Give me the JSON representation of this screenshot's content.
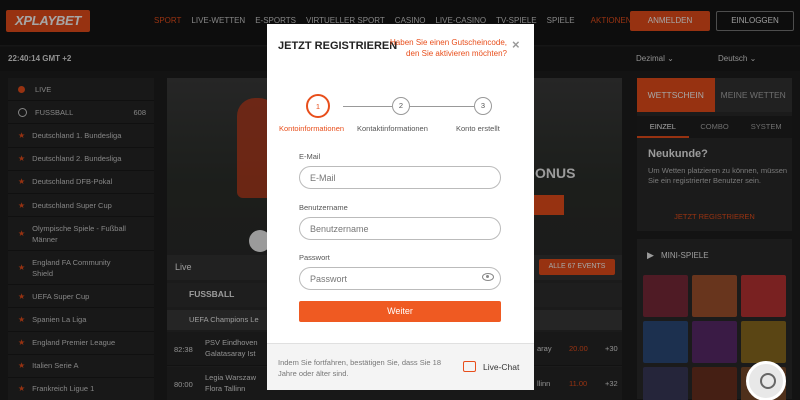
{
  "header": {
    "logo": "XPLAYBET",
    "nav": [
      "SPORT",
      "LIVE-WETTEN",
      "E-SPORTS",
      "VIRTUELLER SPORT",
      "CASINO",
      "LIVE-CASINO",
      "TV-SPIELE",
      "SPIELE",
      "AKTIONEN"
    ],
    "register_label": "ANMELDEN",
    "login_label": "EINLOGGEN"
  },
  "subbar": {
    "time": "22:40:14 GMT +2",
    "odds_format": "Dezimal",
    "language": "Deutsch"
  },
  "sidebar": {
    "items": [
      {
        "label": "LIVE"
      },
      {
        "label": "FUSSBALL",
        "count": "608"
      },
      {
        "label": "Deutschland 1. Bundesliga"
      },
      {
        "label": "Deutschland 2. Bundesliga"
      },
      {
        "label": "Deutschland DFB-Pokal"
      },
      {
        "label": "Deutschland Super Cup"
      },
      {
        "label": "Olympische Spiele - Fußball Männer"
      },
      {
        "label": "England FA Community Shield"
      },
      {
        "label": "UEFA Super Cup"
      },
      {
        "label": "Spanien La Liga"
      },
      {
        "label": "England Premier League"
      },
      {
        "label": "Italien Serie A"
      },
      {
        "label": "Frankreich Ligue 1"
      }
    ]
  },
  "center": {
    "banner_text": "ONUS",
    "live_label": "Live",
    "all_events": "ALLE 67 EVENTS",
    "sport_header": "FUSSBALL",
    "league": "UEFA Champions Le",
    "matches": [
      {
        "time": "82:38",
        "home": "PSV Eindhoven",
        "away": "Galatasaray Ist",
        "right_team": "aray",
        "odd": "20.00",
        "more": "+30"
      },
      {
        "time": "80:00",
        "home": "Legia Warszaw",
        "away": "Flora Tallinn",
        "right_team": "llinn",
        "odd": "11.00",
        "more": "+32"
      }
    ]
  },
  "betslip": {
    "tabs": [
      "WETTSCHEIN",
      "MEINE WETTEN"
    ],
    "subtabs": [
      "EINZEL",
      "COMBO",
      "SYSTEM"
    ],
    "heading": "Neukunde?",
    "text": "Um Wetten platzieren zu können, müssen Sie ein registrierter Benutzer sein.",
    "cta": "JETZT REGISTRIEREN"
  },
  "mini_games": {
    "title": "MINI-SPIELE"
  },
  "modal": {
    "title": "JETZT REGISTRIEREN",
    "voucher_link": "Haben Sie einen Gutscheincode, den Sie aktivieren möchten?",
    "close": "×",
    "steps": [
      {
        "num": "1",
        "label": "Kontoinformationen"
      },
      {
        "num": "2",
        "label": "Kontaktinformationen"
      },
      {
        "num": "3",
        "label": "Konto erstellt"
      }
    ],
    "fields": {
      "email_label": "E-Mail",
      "email_placeholder": "E-Mail",
      "username_label": "Benutzername",
      "username_placeholder": "Benutzername",
      "password_label": "Passwort",
      "password_placeholder": "Passwort"
    },
    "next_label": "Weiter",
    "footer_text": "Indem Sie fortfahren, bestätigen Sie, dass Sie 18 Jahre oder älter sind.",
    "live_chat": "Live-Chat"
  },
  "colors": {
    "accent": "#e84e1b",
    "background": "#1e1e1e"
  }
}
